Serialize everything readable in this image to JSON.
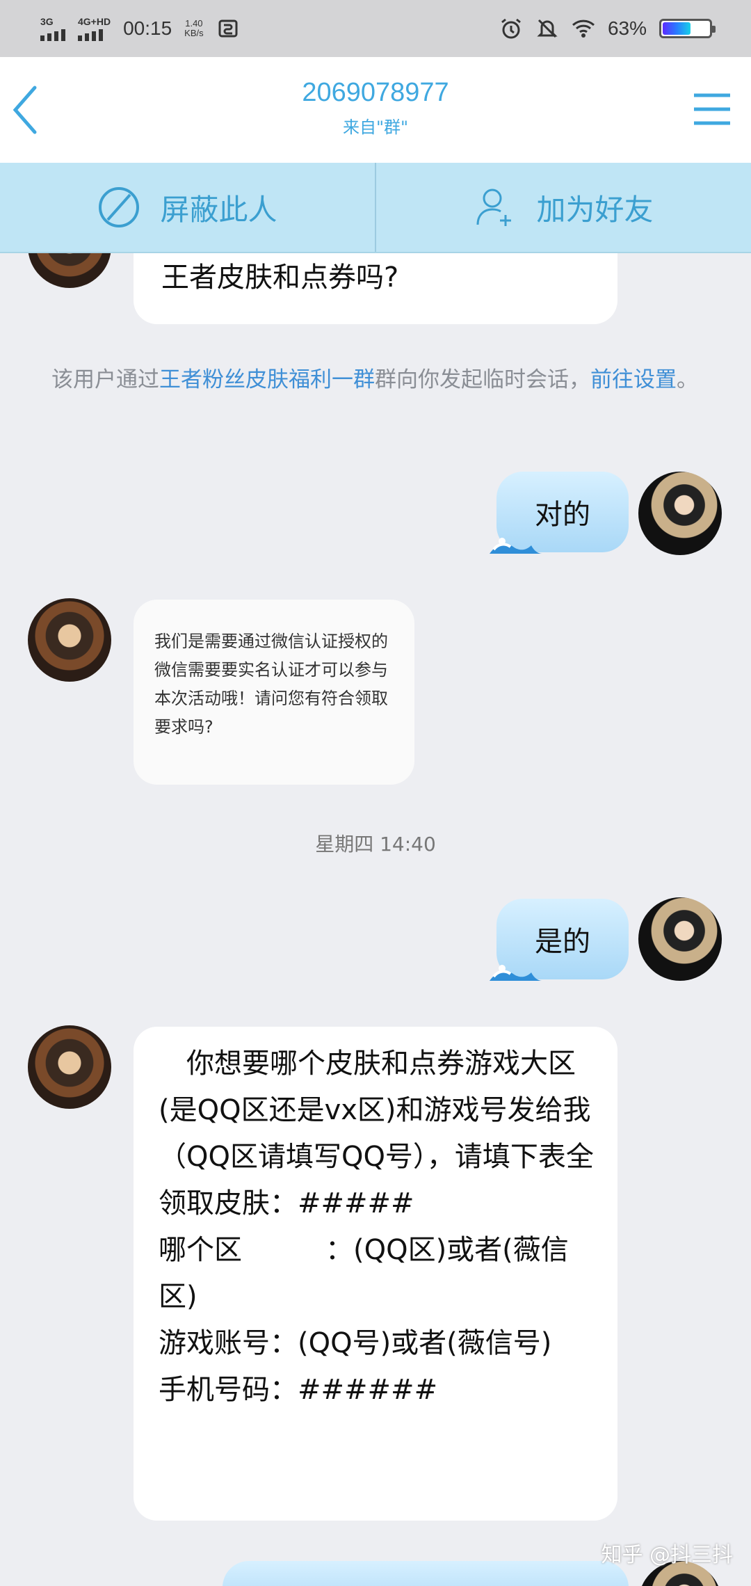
{
  "status_bar": {
    "net1": "3G",
    "net2": "4G+HD",
    "time": "00:15",
    "speed_value": "1.40",
    "speed_unit": "KB/s",
    "battery_percent": "63%",
    "battery_level": 0.63
  },
  "header": {
    "title": "2069078977",
    "subtitle": "来自\"群\""
  },
  "actions": {
    "block_label": "屏蔽此人",
    "add_friend_label": "加为好友"
  },
  "messages": {
    "top_partial": "王者皮肤和点券吗?",
    "notice_prefix": "该用户通过",
    "notice_group": "王者粉丝皮肤福利一群",
    "notice_middle": "群向你发起临时会话，",
    "notice_link": "前往设置",
    "notice_suffix": "。",
    "reply1": "对的",
    "her_msg1": "我们是需要通过微信认证授权的微信需要要实名认证才可以参与本次活动哦！请问您有符合领取要求吗?",
    "timestamp": "星期四 14:40",
    "reply2": "是的",
    "her_msg2": "　你想要哪个皮肤和点券游戏大区(是QQ区还是vx区)和游戏号发给我（QQ区请填写QQ号），请填下表全\n领取皮肤：#####\n哪个区　　　：(QQ区)或者(薇信区)\n游戏账号：(QQ号)或者(薇信号)\n手机号码：######"
  },
  "watermark": "知乎 @抖三抖",
  "colors": {
    "accent": "#3fa8e0",
    "action_bar": "#bfe5f5",
    "chat_bg": "#edeef2"
  }
}
